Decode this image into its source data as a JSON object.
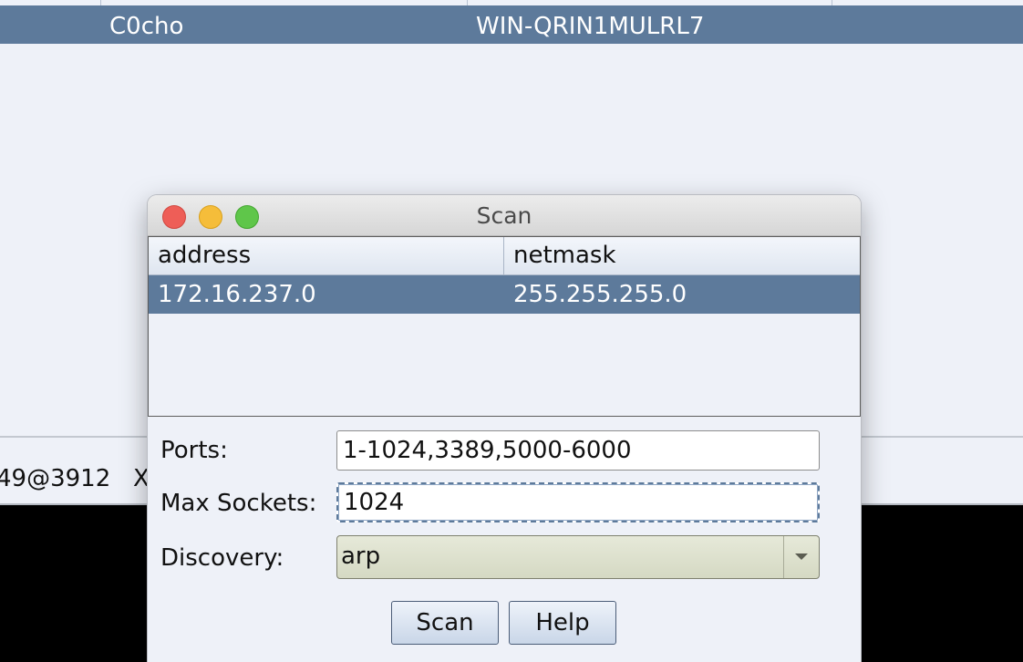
{
  "background": {
    "row": {
      "user": "C0cho",
      "host": "WIN-QRIN1MULRL7"
    },
    "tab_fragments": [
      "49@3912",
      "X"
    ]
  },
  "dialog": {
    "title": "Scan",
    "table": {
      "columns": [
        "address",
        "netmask"
      ],
      "rows": [
        {
          "address": "172.16.237.0",
          "netmask": "255.255.255.0"
        }
      ]
    },
    "ports": {
      "label": "Ports:",
      "value": "1-1024,3389,5000-6000"
    },
    "max_sockets": {
      "label": "Max Sockets:",
      "value": "1024"
    },
    "discovery": {
      "label": "Discovery:",
      "value": "arp"
    },
    "buttons": {
      "scan": "Scan",
      "help": "Help"
    }
  },
  "colors": {
    "selection": "#5d7a9b",
    "close": "#ee5e57",
    "minimize": "#f5bd3a",
    "maximize": "#5fc64a"
  }
}
